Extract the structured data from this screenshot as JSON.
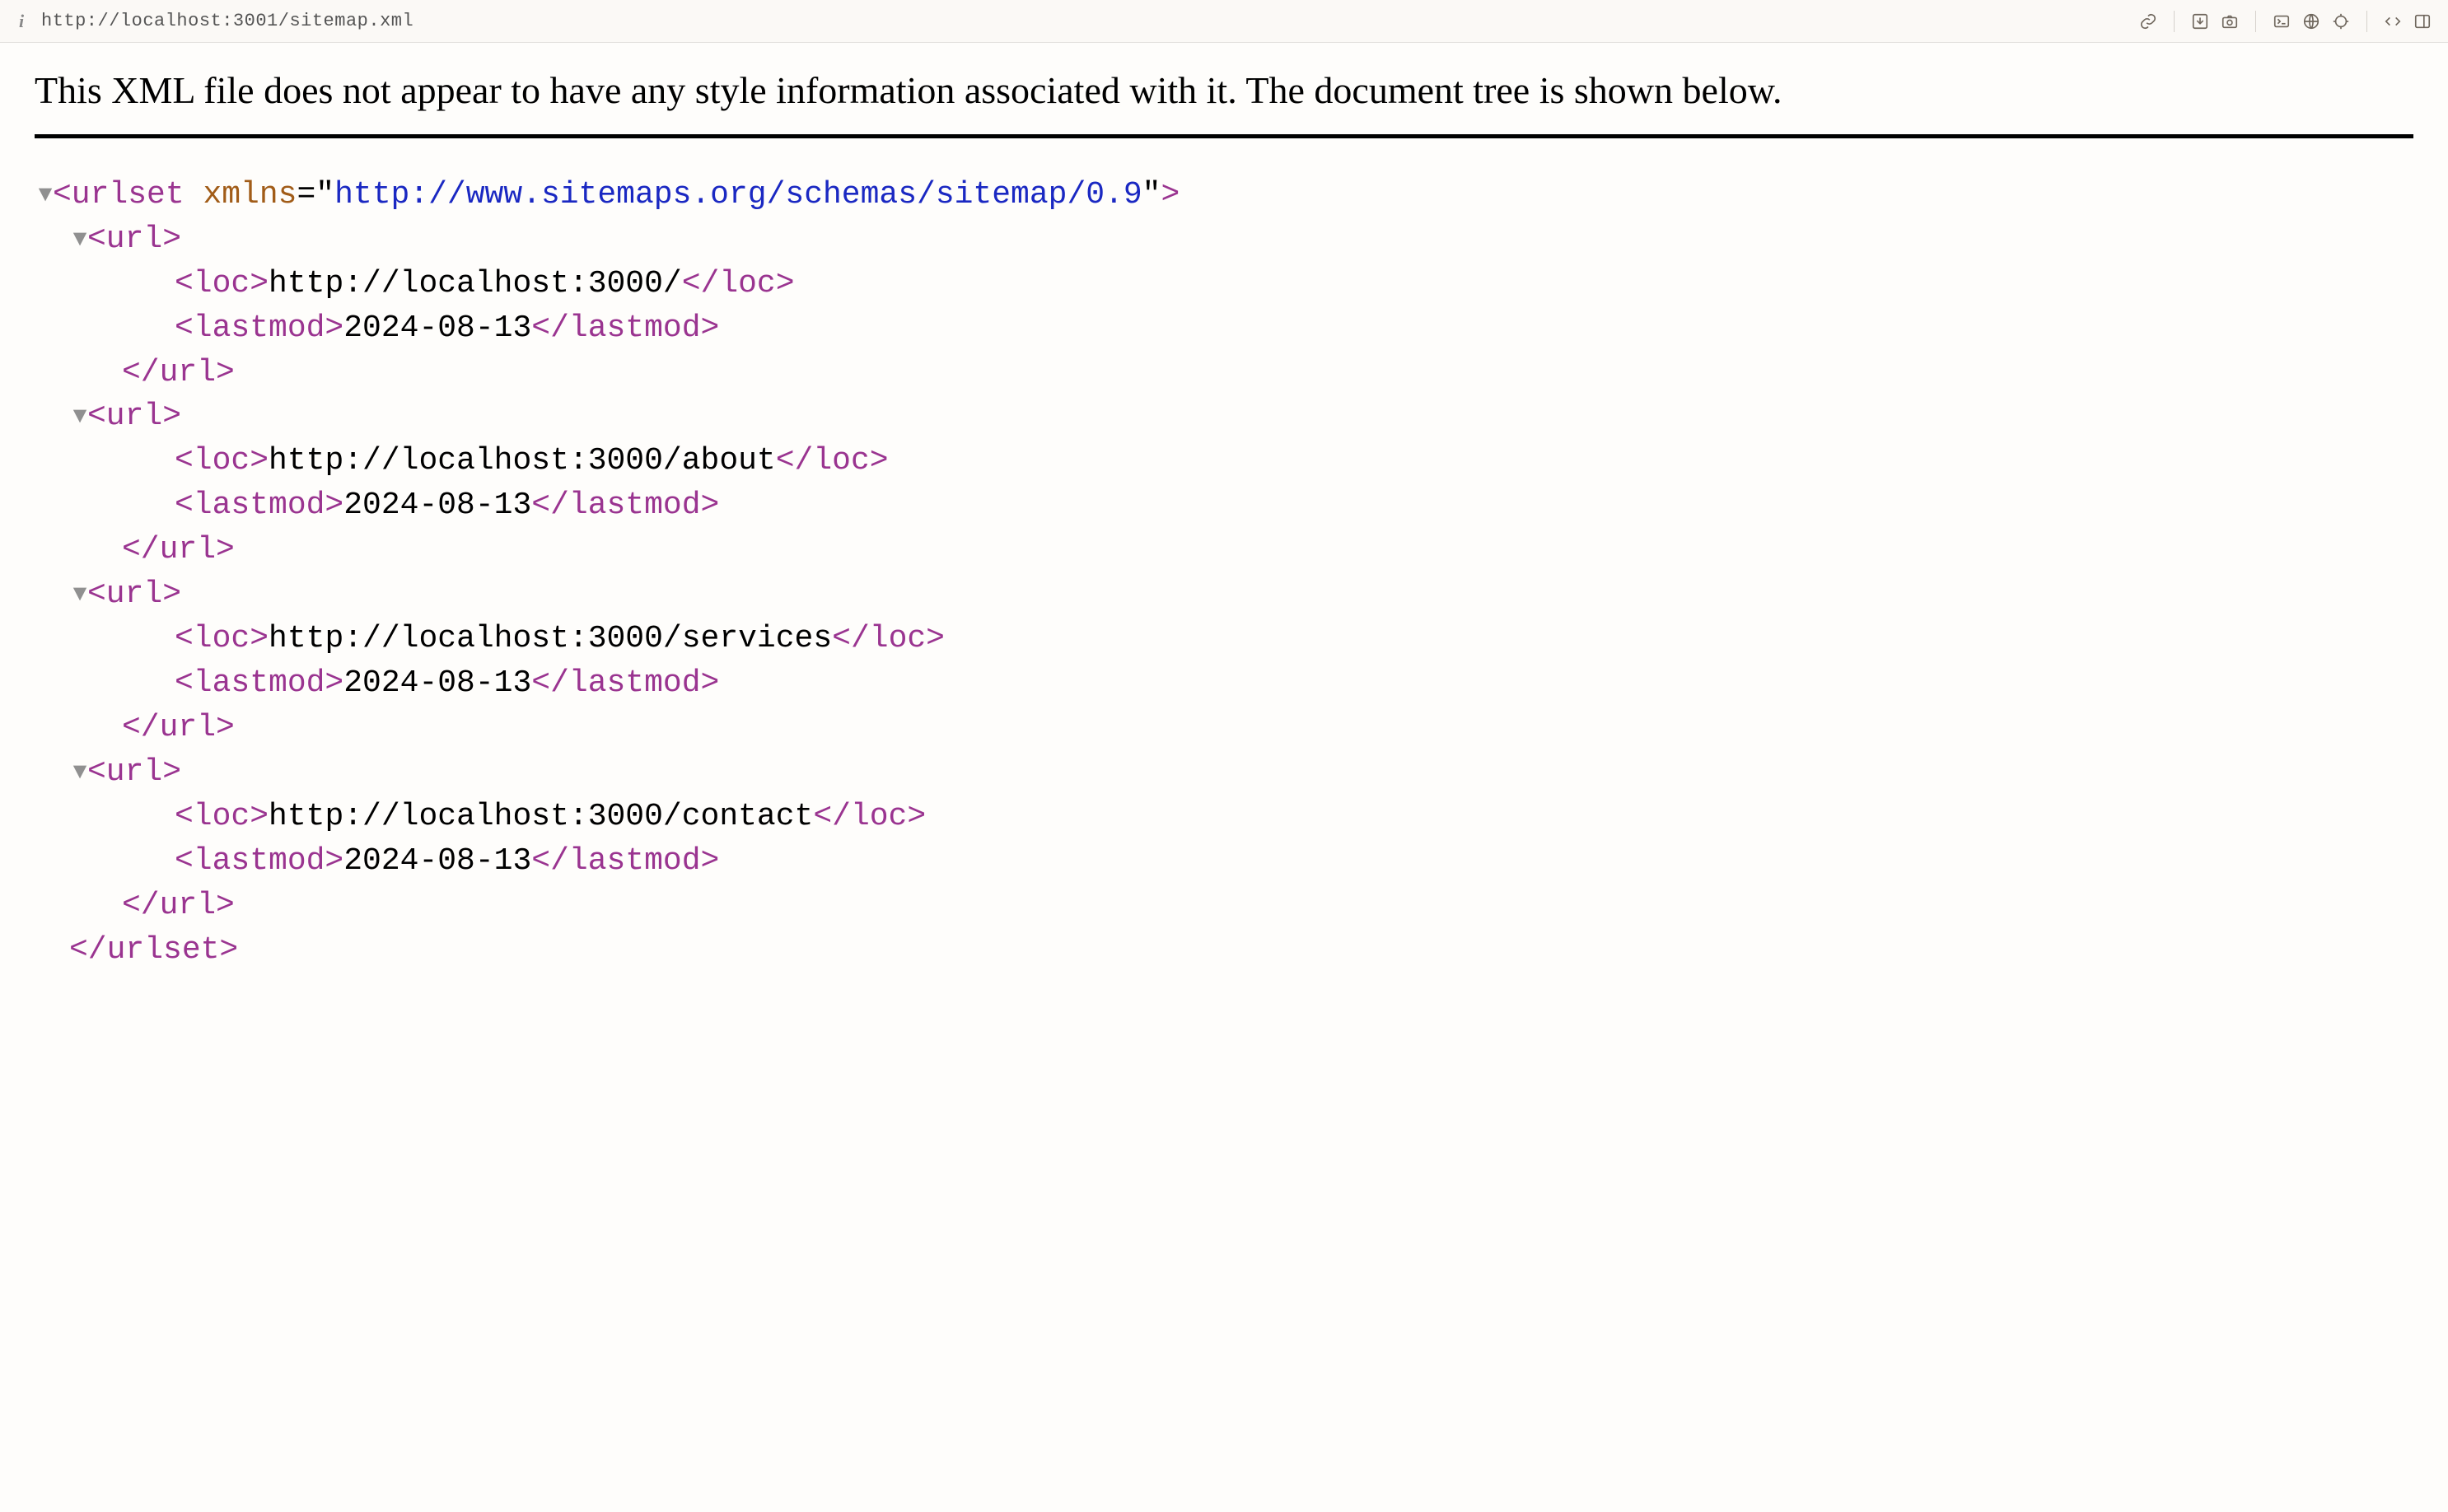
{
  "toolbar": {
    "url": "http://localhost:3001/sitemap.xml"
  },
  "notice": "This XML file does not appear to have any style information associated with it. The document tree is shown below.",
  "xml": {
    "root_tag": "urlset",
    "xmlns_attr": "xmlns",
    "xmlns_value": "http://www.sitemaps.org/schemas/sitemap/0.9",
    "url_tag": "url",
    "loc_tag": "loc",
    "lastmod_tag": "lastmod",
    "entries": [
      {
        "loc": "http://localhost:3000/",
        "lastmod": "2024-08-13"
      },
      {
        "loc": "http://localhost:3000/about",
        "lastmod": "2024-08-13"
      },
      {
        "loc": "http://localhost:3000/services",
        "lastmod": "2024-08-13"
      },
      {
        "loc": "http://localhost:3000/contact",
        "lastmod": "2024-08-13"
      }
    ]
  }
}
